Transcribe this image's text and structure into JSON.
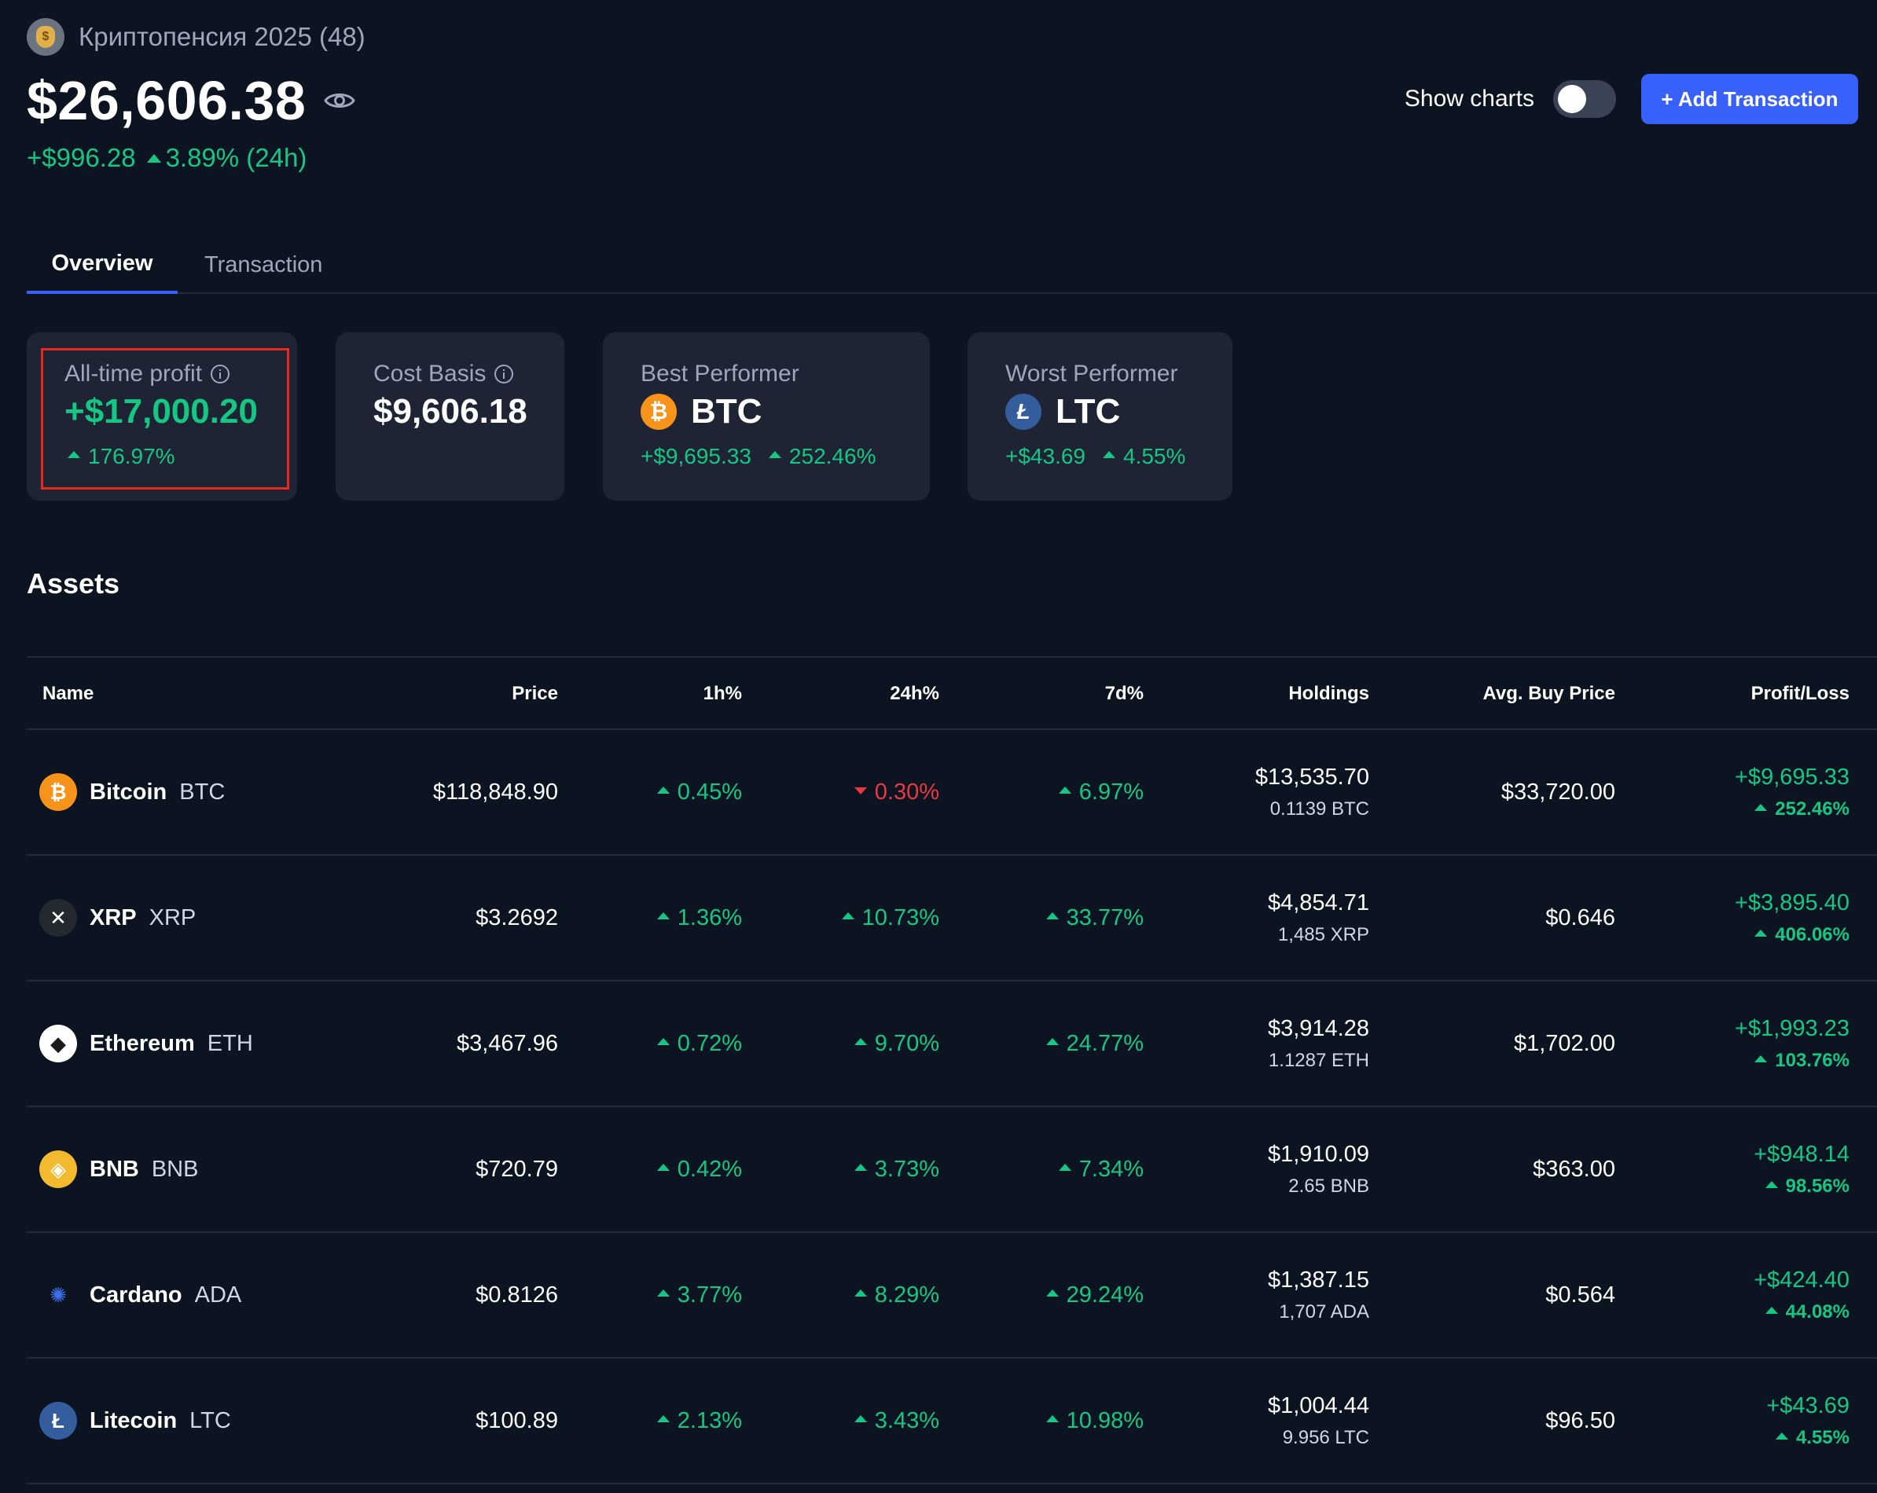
{
  "portfolio": {
    "name": "Криптопенсия 2025 (48)",
    "balance": "$26,606.38",
    "change_abs": "+$996.28",
    "change_pct": "3.89% (24h)"
  },
  "header": {
    "show_charts_label": "Show charts",
    "show_charts_on": false,
    "add_button": "+ Add Transaction"
  },
  "tabs": [
    {
      "label": "Overview",
      "active": true
    },
    {
      "label": "Transaction",
      "active": false
    }
  ],
  "cards": {
    "all_time_profit": {
      "label": "All-time profit",
      "value": "+$17,000.20",
      "pct": "176.97%"
    },
    "cost_basis": {
      "label": "Cost Basis",
      "value": "$9,606.18"
    },
    "best_performer": {
      "label": "Best Performer",
      "symbol": "BTC",
      "abs": "+$9,695.33",
      "pct": "252.46%",
      "icon": "bitcoin-icon"
    },
    "worst_performer": {
      "label": "Worst Performer",
      "symbol": "LTC",
      "abs": "+$43.69",
      "pct": "4.55%",
      "icon": "litecoin-icon"
    }
  },
  "assets": {
    "title": "Assets",
    "columns": [
      "Name",
      "Price",
      "1h%",
      "24h%",
      "7d%",
      "Holdings",
      "Avg. Buy Price",
      "Profit/Loss"
    ],
    "rows": [
      {
        "name": "Bitcoin",
        "symbol": "BTC",
        "price": "$118,848.90",
        "h1": "0.45%",
        "h1_dir": "up",
        "h24": "0.30%",
        "h24_dir": "down",
        "d7": "6.97%",
        "d7_dir": "up",
        "holdings": "$13,535.70",
        "holdings_qty": "0.1139 BTC",
        "avg_buy": "$33,720.00",
        "pl": "+$9,695.33",
        "pl_pct": "252.46%",
        "icon": "bitcoin-icon",
        "color": "#f7931a"
      },
      {
        "name": "XRP",
        "symbol": "XRP",
        "price": "$3.2692",
        "h1": "1.36%",
        "h1_dir": "up",
        "h24": "10.73%",
        "h24_dir": "up",
        "d7": "33.77%",
        "d7_dir": "up",
        "holdings": "$4,854.71",
        "holdings_qty": "1,485 XRP",
        "avg_buy": "$0.646",
        "pl": "+$3,895.40",
        "pl_pct": "406.06%",
        "icon": "xrp-icon",
        "color": "#23292f"
      },
      {
        "name": "Ethereum",
        "symbol": "ETH",
        "price": "$3,467.96",
        "h1": "0.72%",
        "h1_dir": "up",
        "h24": "9.70%",
        "h24_dir": "up",
        "d7": "24.77%",
        "d7_dir": "up",
        "holdings": "$3,914.28",
        "holdings_qty": "1.1287 ETH",
        "avg_buy": "$1,702.00",
        "pl": "+$1,993.23",
        "pl_pct": "103.76%",
        "icon": "ethereum-icon",
        "color": "#ffffff"
      },
      {
        "name": "BNB",
        "symbol": "BNB",
        "price": "$720.79",
        "h1": "0.42%",
        "h1_dir": "up",
        "h24": "3.73%",
        "h24_dir": "up",
        "d7": "7.34%",
        "d7_dir": "up",
        "holdings": "$1,910.09",
        "holdings_qty": "2.65 BNB",
        "avg_buy": "$363.00",
        "pl": "+$948.14",
        "pl_pct": "98.56%",
        "icon": "bnb-icon",
        "color": "#f3ba2f"
      },
      {
        "name": "Cardano",
        "symbol": "ADA",
        "price": "$0.8126",
        "h1": "3.77%",
        "h1_dir": "up",
        "h24": "8.29%",
        "h24_dir": "up",
        "d7": "29.24%",
        "d7_dir": "up",
        "holdings": "$1,387.15",
        "holdings_qty": "1,707 ADA",
        "avg_buy": "$0.564",
        "pl": "+$424.40",
        "pl_pct": "44.08%",
        "icon": "cardano-icon",
        "color": "#0033ad"
      },
      {
        "name": "Litecoin",
        "symbol": "LTC",
        "price": "$100.89",
        "h1": "2.13%",
        "h1_dir": "up",
        "h24": "3.43%",
        "h24_dir": "up",
        "d7": "10.98%",
        "d7_dir": "up",
        "holdings": "$1,004.44",
        "holdings_qty": "9.956 LTC",
        "avg_buy": "$96.50",
        "pl": "+$43.69",
        "pl_pct": "4.55%",
        "icon": "litecoin-icon",
        "color": "#345d9d"
      }
    ]
  },
  "colors": {
    "background": "#0d1421",
    "card": "#1e2433",
    "accent": "#3861fb",
    "positive": "#16c784",
    "negative": "#ea3943",
    "highlight": "#e8281e"
  }
}
